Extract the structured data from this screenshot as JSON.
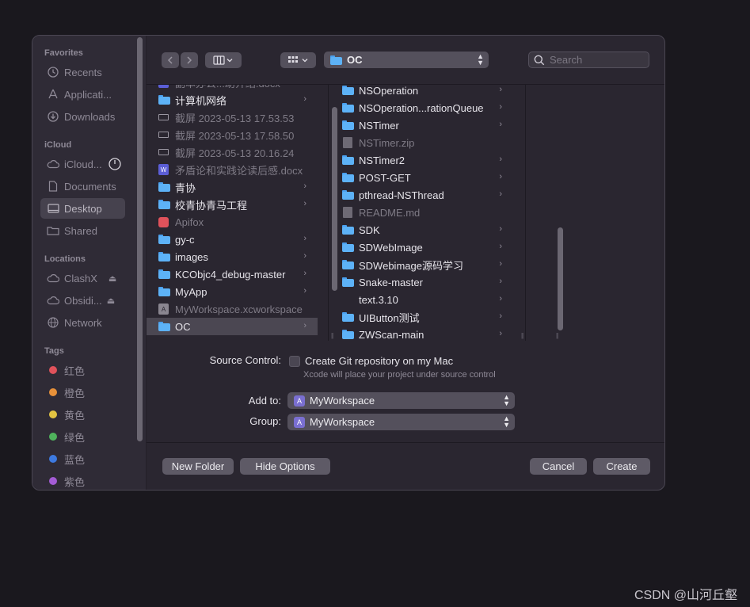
{
  "sidebar": {
    "sections": {
      "favorites": "Favorites",
      "icloud": "iCloud",
      "locations": "Locations",
      "tags": "Tags"
    },
    "favorites": [
      "Recents",
      "Applicati...",
      "Downloads"
    ],
    "icloud": [
      "iCloud...",
      "Documents",
      "Desktop",
      "Shared"
    ],
    "locations": [
      "ClashX",
      "Obsidi...",
      "Network"
    ],
    "tags": [
      {
        "label": "红色",
        "color": "#e0525b"
      },
      {
        "label": "橙色",
        "color": "#e8913a"
      },
      {
        "label": "黄色",
        "color": "#e3c442"
      },
      {
        "label": "绿色",
        "color": "#4fb35c"
      },
      {
        "label": "蓝色",
        "color": "#3d7ae0"
      },
      {
        "label": "紫色",
        "color": "#a45cd6"
      }
    ]
  },
  "toolbar": {
    "path": "OC",
    "search_placeholder": "Search"
  },
  "column1": [
    {
      "label": "副本办公...助介绍.docx",
      "kind": "word",
      "dim": true
    },
    {
      "label": "计算机网络",
      "kind": "folder",
      "chevron": true
    },
    {
      "label": "截屏 2023-05-13 17.53.53",
      "kind": "shot",
      "dim": true
    },
    {
      "label": "截屏 2023-05-13 17.58.50",
      "kind": "shot",
      "dim": true
    },
    {
      "label": "截屏 2023-05-13 20.16.24",
      "kind": "shot",
      "dim": true
    },
    {
      "label": "矛盾论和实践论读后感.docx",
      "kind": "word",
      "dim": true
    },
    {
      "label": "青协",
      "kind": "folder",
      "chevron": true
    },
    {
      "label": "校青协青马工程",
      "kind": "folder",
      "chevron": true
    },
    {
      "label": "Apifox",
      "kind": "apifox",
      "dim": true
    },
    {
      "label": "gy-c",
      "kind": "folder",
      "chevron": true
    },
    {
      "label": "images",
      "kind": "folder",
      "chevron": true
    },
    {
      "label": "KCObjc4_debug-master",
      "kind": "folder",
      "chevron": true
    },
    {
      "label": "MyApp",
      "kind": "folder",
      "chevron": true
    },
    {
      "label": "MyWorkspace.xcworkspace",
      "kind": "xcws",
      "dim": true
    },
    {
      "label": "OC",
      "kind": "folder",
      "chevron": true,
      "selected": true
    }
  ],
  "column2": [
    {
      "label": "NSOperation",
      "kind": "folder",
      "chevron": true
    },
    {
      "label": "NSOperation...rationQueue",
      "kind": "folder",
      "chevron": true
    },
    {
      "label": "NSTimer",
      "kind": "folder",
      "chevron": true
    },
    {
      "label": "NSTimer.zip",
      "kind": "doc",
      "dim": true
    },
    {
      "label": "NSTimer2",
      "kind": "folder",
      "chevron": true
    },
    {
      "label": "POST-GET",
      "kind": "folder",
      "chevron": true
    },
    {
      "label": "pthread-NSThread",
      "kind": "folder",
      "chevron": true
    },
    {
      "label": "README.md",
      "kind": "doc",
      "dim": true
    },
    {
      "label": "SDK",
      "kind": "folder",
      "chevron": true
    },
    {
      "label": "SDWebImage",
      "kind": "folder",
      "chevron": true
    },
    {
      "label": "SDWebimage源码学习",
      "kind": "folder",
      "chevron": true
    },
    {
      "label": "Snake-master",
      "kind": "folder",
      "chevron": true
    },
    {
      "label": "text.3.10",
      "kind": "blank",
      "chevron": true
    },
    {
      "label": "UIButton测试",
      "kind": "folder",
      "chevron": true
    },
    {
      "label": "ZWScan-main",
      "kind": "folder",
      "chevron": true
    }
  ],
  "options": {
    "source_control_label": "Source Control:",
    "git_checkbox_label": "Create Git repository on my Mac",
    "git_hint": "Xcode will place your project under source control",
    "add_to_label": "Add to:",
    "add_to_value": "MyWorkspace",
    "group_label": "Group:",
    "group_value": "MyWorkspace"
  },
  "buttons": {
    "new_folder": "New Folder",
    "hide_options": "Hide Options",
    "cancel": "Cancel",
    "create": "Create"
  },
  "watermark": "CSDN @山河丘壑"
}
